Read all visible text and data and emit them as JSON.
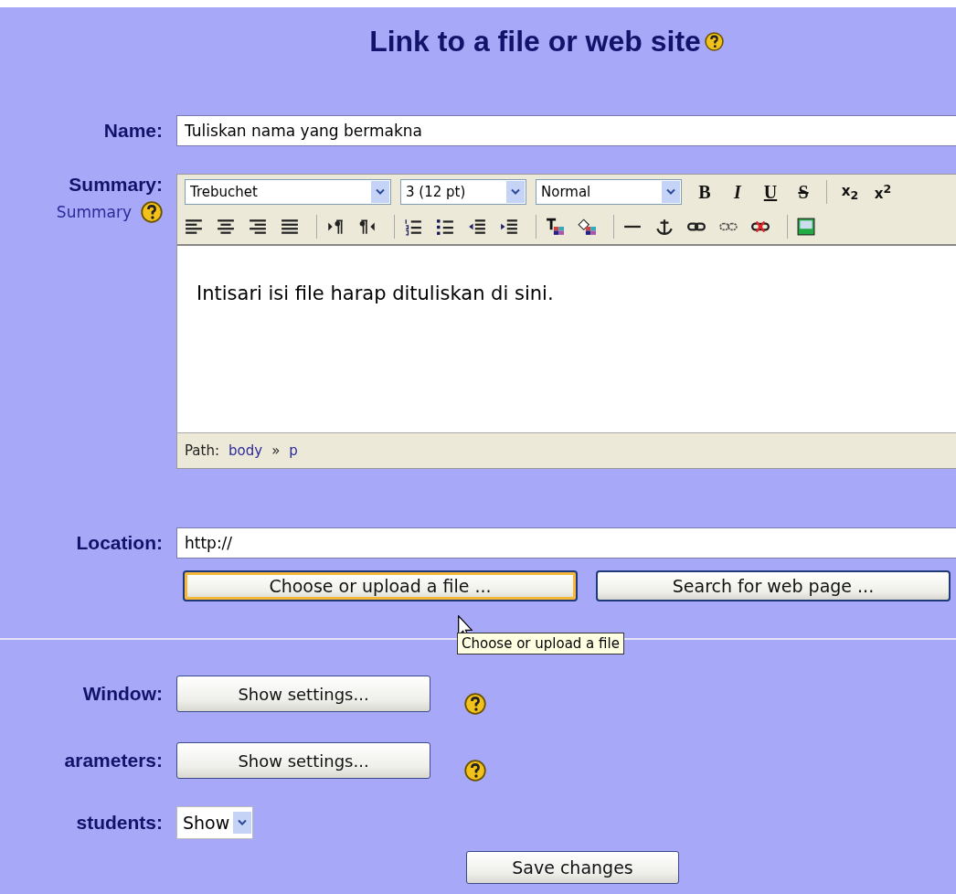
{
  "title": "Link to a file or web site",
  "name_field": {
    "label": "Name:",
    "value": "Tuliskan nama yang bermakna"
  },
  "summary": {
    "label": "Summary:",
    "help_link": "Summary",
    "selects": [
      {
        "value": "Trebuchet",
        "kind": "wide"
      },
      {
        "value": "3 (12 pt)",
        "kind": "narrow"
      },
      {
        "value": "Normal",
        "kind": "wide"
      }
    ],
    "format_buttons": [
      {
        "label": "B",
        "kind": "bold"
      },
      {
        "label": "I",
        "kind": "italic"
      },
      {
        "label": "U",
        "kind": "underline"
      },
      {
        "label": "S",
        "kind": "strike"
      },
      {
        "kind": "separator"
      },
      {
        "label": "x$_{2}$",
        "kind": "sub"
      },
      {
        "label": "x$^{2}$",
        "kind": "sup"
      }
    ],
    "tools": [
      {
        "kind": "align-left"
      },
      {
        "kind": "align-center"
      },
      {
        "kind": "align-right"
      },
      {
        "kind": "justify"
      },
      {
        "kind": "separator"
      },
      {
        "kind": "ltr"
      },
      {
        "kind": "rtl"
      },
      {
        "kind": "separator"
      },
      {
        "kind": "ordered-list"
      },
      {
        "kind": "bullet-list"
      },
      {
        "kind": "outdent"
      },
      {
        "kind": "indent"
      },
      {
        "kind": "separator"
      },
      {
        "kind": "text-color"
      },
      {
        "kind": "fill-color"
      },
      {
        "kind": "separator"
      },
      {
        "kind": "rule"
      },
      {
        "kind": "anchor"
      },
      {
        "kind": "link"
      },
      {
        "kind": "unlink"
      },
      {
        "kind": "nolink"
      },
      {
        "kind": "separator"
      },
      {
        "kind": "image"
      }
    ],
    "content": "Intisari isi file harap dituliskan di sini.",
    "path_label": "Path:",
    "path": [
      {
        "text": "body"
      },
      {
        "text": "»",
        "kind": "sep"
      },
      {
        "text": "p"
      }
    ]
  },
  "location": {
    "label": "Location:",
    "value": "http://",
    "buttons": [
      {
        "label": "Choose or upload a file ...",
        "focused": true
      },
      {
        "label": "Search for web page ...",
        "focused": false
      }
    ],
    "tooltip": "Choose or upload a file"
  },
  "settings": [
    {
      "label": "Window:",
      "kind": "button",
      "value": "Show settings..."
    },
    {
      "label": "arameters:",
      "kind": "button",
      "value": "Show settings..."
    },
    {
      "label": "students:",
      "kind": "select",
      "value": "Show"
    }
  ],
  "save": "Save changes"
}
